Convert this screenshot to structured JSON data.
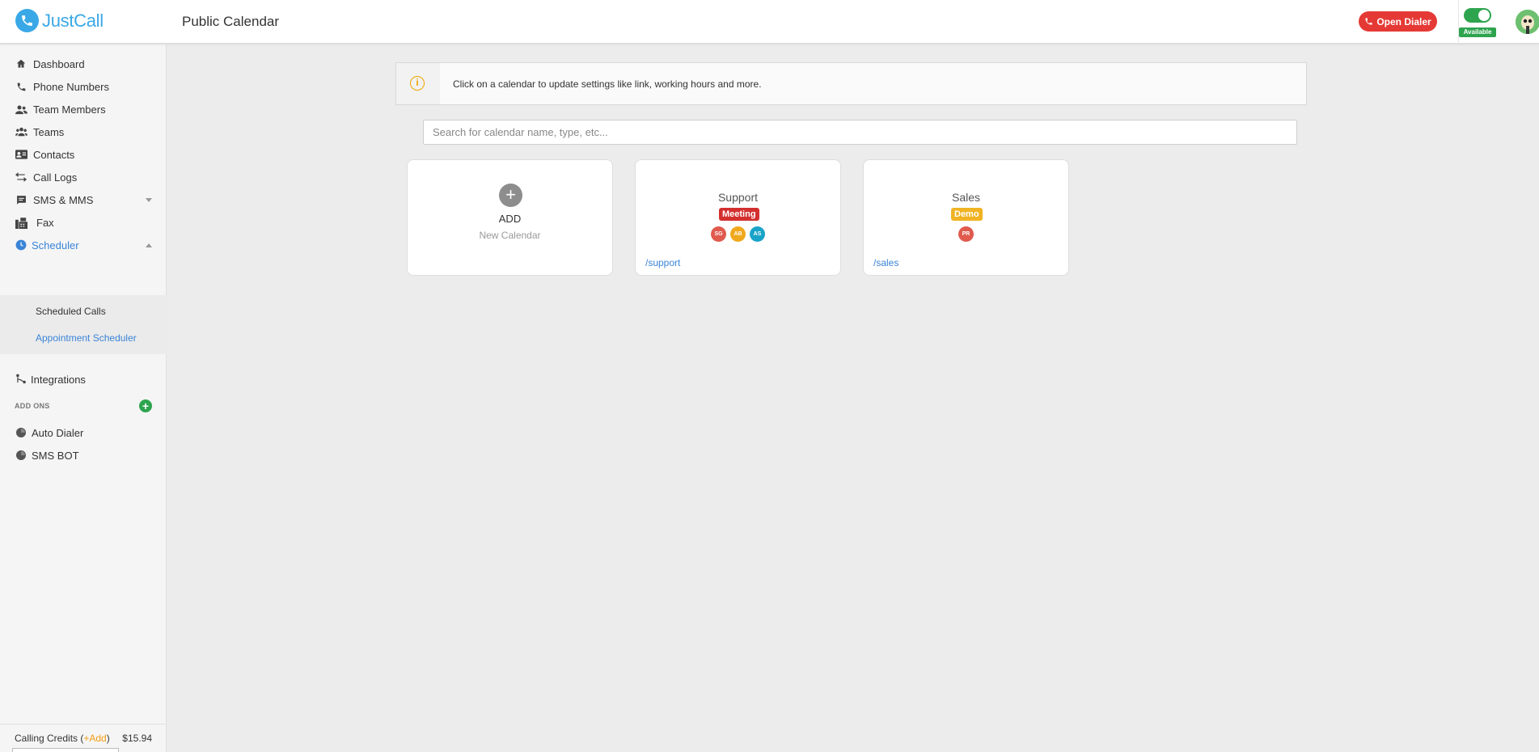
{
  "header": {
    "app_name": "JustCall",
    "page_title": "Public Calendar",
    "open_dialer_label": "Open Dialer",
    "availability_status": "Available"
  },
  "sidebar": {
    "items": [
      {
        "label": "Dashboard",
        "icon": "home-icon"
      },
      {
        "label": "Phone Numbers",
        "icon": "phone-icon"
      },
      {
        "label": "Team Members",
        "icon": "users-icon"
      },
      {
        "label": "Teams",
        "icon": "teams-icon"
      },
      {
        "label": "Contacts",
        "icon": "contact-card-icon"
      },
      {
        "label": "Call Logs",
        "icon": "swap-arrows-icon"
      },
      {
        "label": "SMS & MMS",
        "icon": "chat-icon"
      },
      {
        "label": "Fax",
        "icon": "fax-icon"
      },
      {
        "label": "Scheduler",
        "icon": "clock-icon"
      }
    ],
    "scheduler_sub": [
      "Scheduled Calls",
      "Appointment Scheduler"
    ],
    "integrations": "Integrations",
    "addons_label": "ADD ONS",
    "addons": [
      "Auto Dialer",
      "SMS BOT"
    ],
    "credits": {
      "label": "Calling Credits (",
      "add": "+Add",
      "close": ")",
      "amount": "$15.94"
    }
  },
  "main": {
    "info_text": "Click on a calendar to update settings like link, working hours and more.",
    "search_placeholder": "Search for calendar name, type, etc...",
    "add_card": {
      "title": "ADD",
      "subtitle": "New Calendar"
    },
    "calendars": [
      {
        "name": "Support",
        "type": "Meeting",
        "type_color": "#d32f2f",
        "members": [
          {
            "initials": "SG",
            "color": "#e05a4e"
          },
          {
            "initials": "AB",
            "color": "#f0a81c"
          },
          {
            "initials": "AS",
            "color": "#1aa3c9"
          }
        ],
        "link": "/support"
      },
      {
        "name": "Sales",
        "type": "Demo",
        "type_color": "#f0b323",
        "members": [
          {
            "initials": "PR",
            "color": "#e05a4e"
          }
        ],
        "link": "/sales"
      }
    ]
  },
  "colors": {
    "accent": "#3a84d8",
    "danger": "#e53935",
    "success": "#2ea44f"
  }
}
